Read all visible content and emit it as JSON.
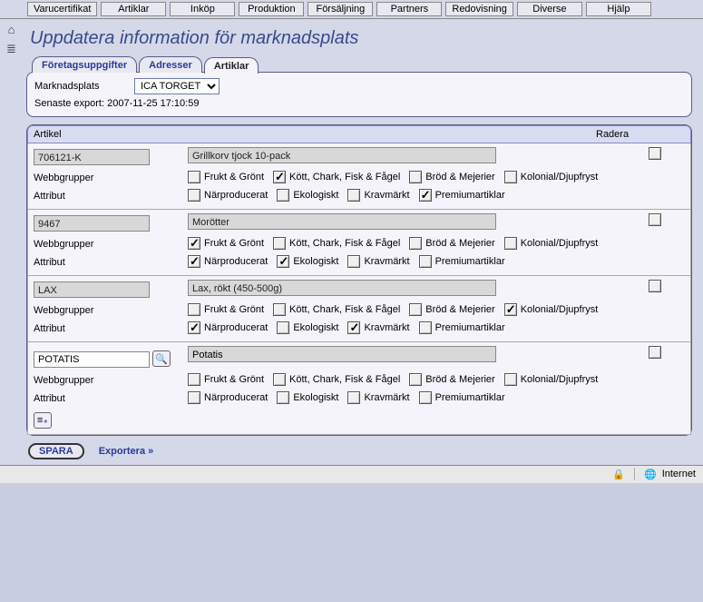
{
  "menu": [
    "Varucertifikat",
    "Artiklar",
    "Inköp",
    "Produktion",
    "Försäljning",
    "Partners",
    "Redovisning",
    "Diverse",
    "Hjälp"
  ],
  "page_title": "Uppdatera information för marknadsplats",
  "tabs": {
    "t0": "Företagsuppgifter",
    "t1": "Adresser",
    "t2": "Artiklar"
  },
  "mp": {
    "label": "Marknadsplats",
    "selected": "ICA TORGET",
    "export_line": "Senaste export: 2007-11-25 17:10:59"
  },
  "headers": {
    "artikel": "Artikel",
    "radera": "Radera"
  },
  "labels": {
    "webbgrupper": "Webbgrupper",
    "attribut": "Attribut"
  },
  "groups": {
    "g0": "Frukt & Grönt",
    "g1": "Kött, Chark, Fisk & Fågel",
    "g2": "Bröd & Mejerier",
    "g3": "Kolonial/Djupfryst"
  },
  "attrs": {
    "a0": "Närproducerat",
    "a1": "Ekologiskt",
    "a2": "Kravmärkt",
    "a3": "Premiumartiklar"
  },
  "rows": {
    "r0": {
      "code": "706121-K",
      "desc": "Grillkorv tjock 10-pack"
    },
    "r1": {
      "code": "9467",
      "desc": "Morötter"
    },
    "r2": {
      "code": "LAX",
      "desc": "Lax, rökt (450-500g)"
    },
    "r3": {
      "code": "POTATIS",
      "desc": "Potatis"
    }
  },
  "footer": {
    "save": "SPARA",
    "export": "Exportera »"
  },
  "status": {
    "zone": "Internet"
  }
}
